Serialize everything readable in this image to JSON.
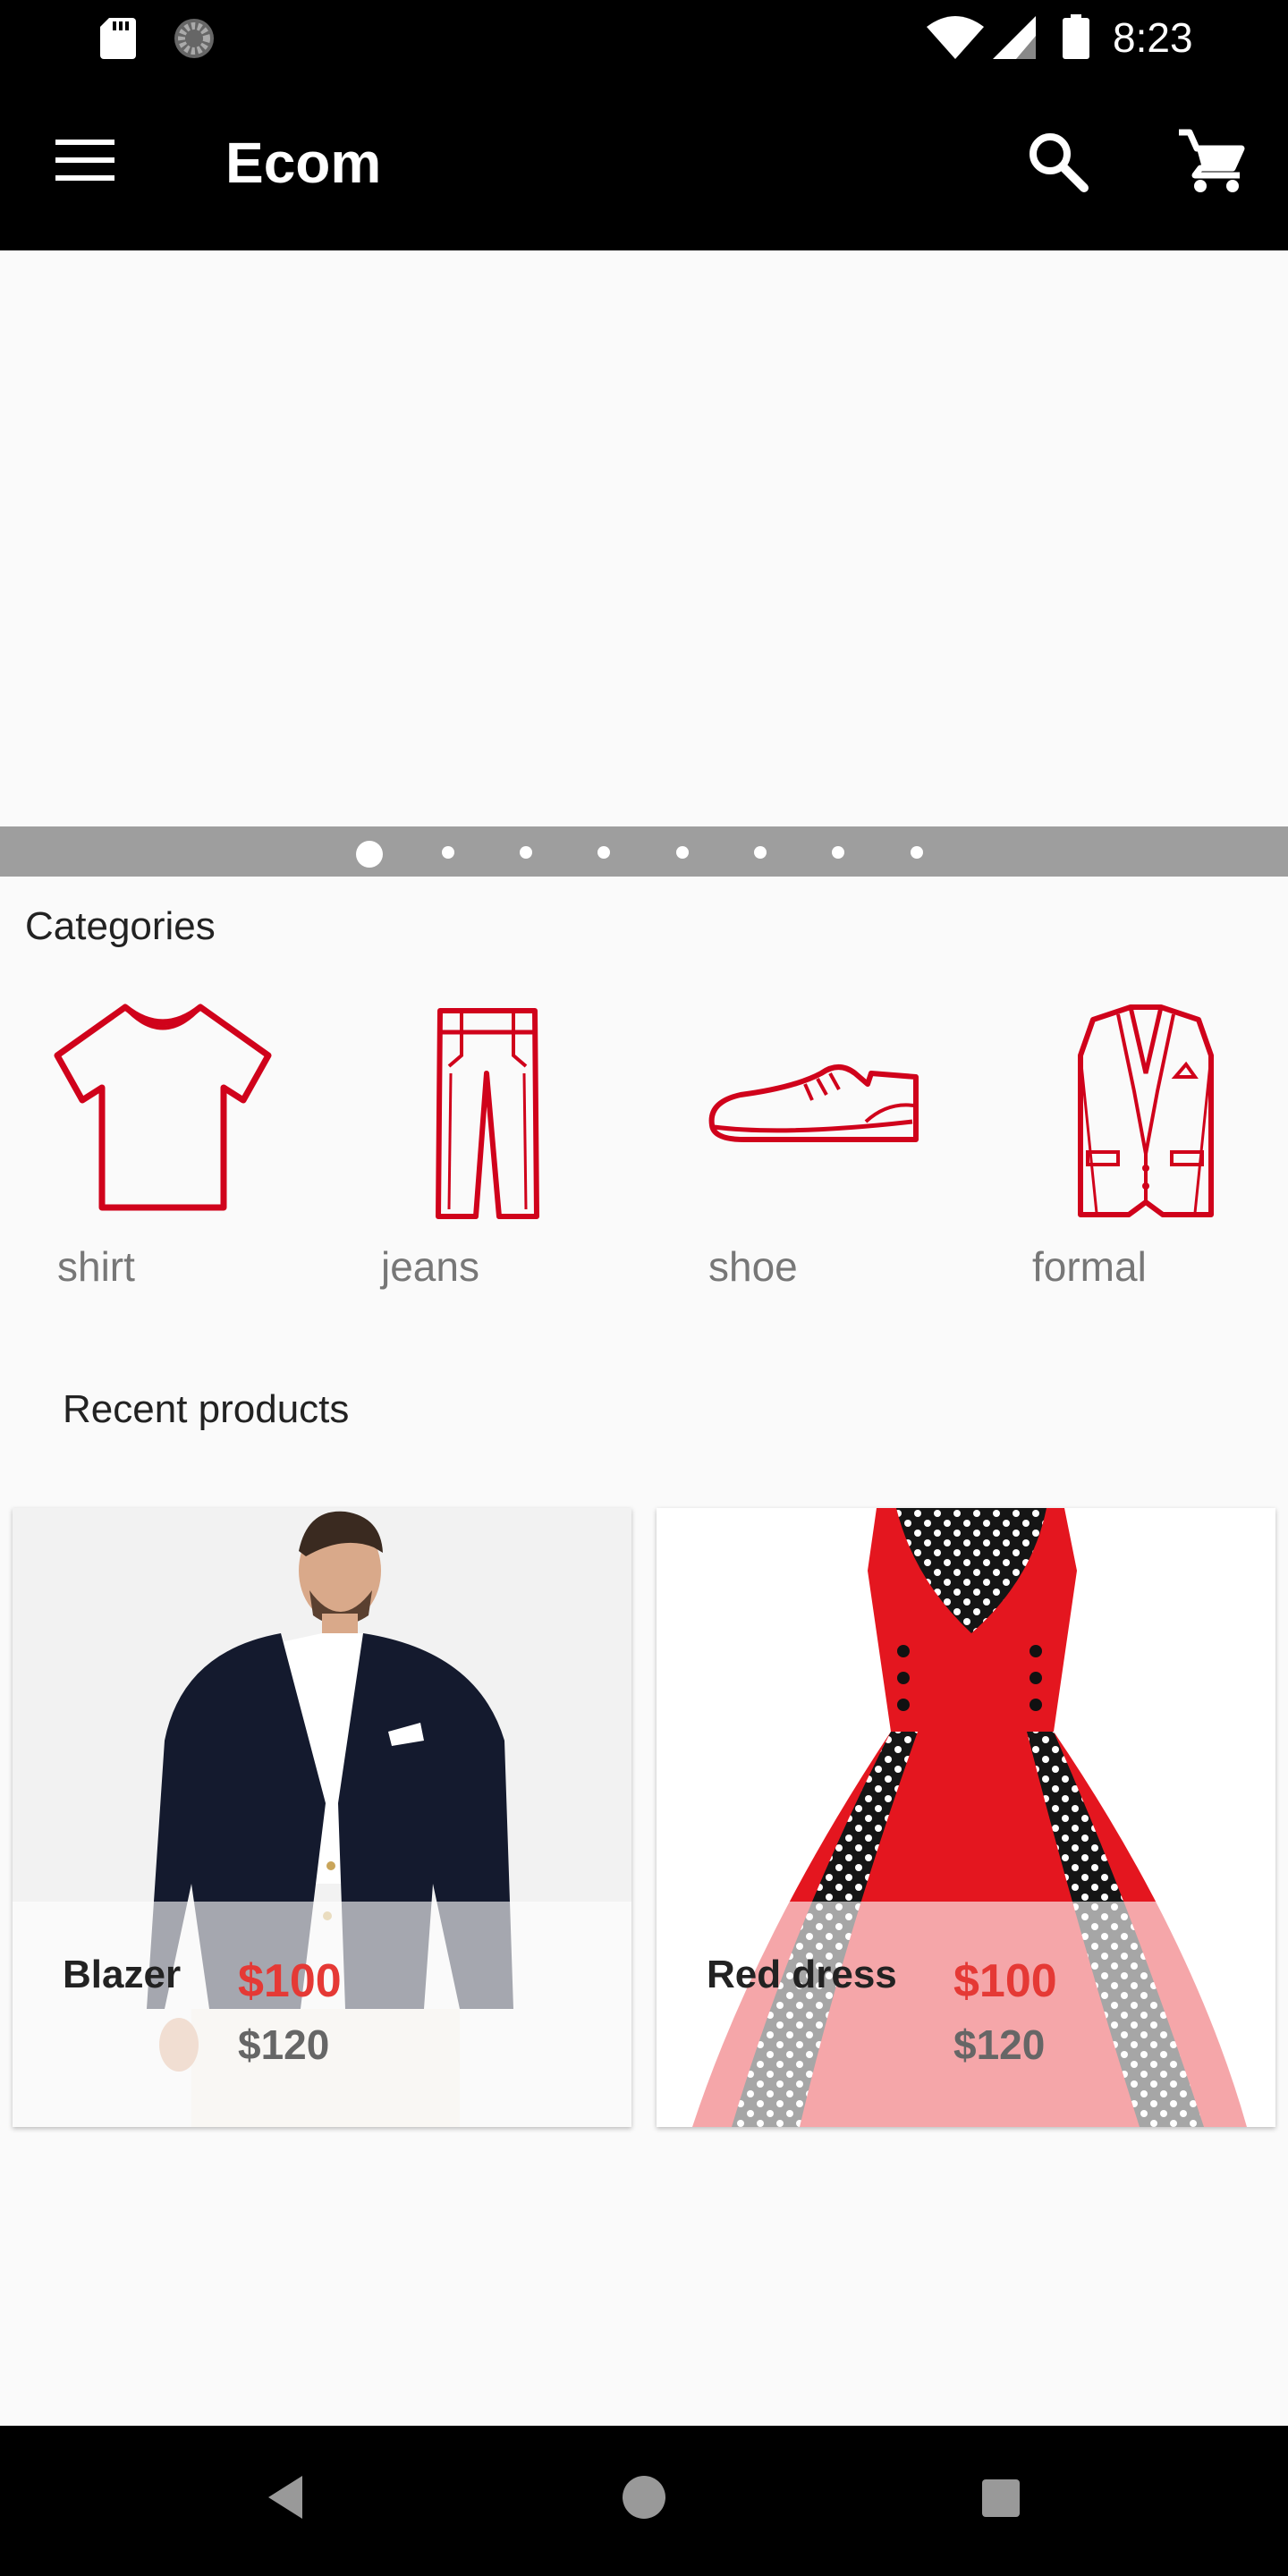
{
  "status_bar": {
    "time": "8:23",
    "icons": [
      "sd-card-icon",
      "spinner-icon",
      "wifi-icon",
      "signal-icon",
      "battery-icon"
    ]
  },
  "app_bar": {
    "title": "Ecom",
    "icons": [
      "menu-icon",
      "search-icon",
      "cart-icon"
    ]
  },
  "carousel": {
    "dot_count": 8,
    "active_index": 0
  },
  "categories": {
    "title": "Categories",
    "items": [
      {
        "label": "shirt",
        "icon": "shirt-icon"
      },
      {
        "label": "jeans",
        "icon": "jeans-icon"
      },
      {
        "label": "shoe",
        "icon": "shoe-icon"
      },
      {
        "label": "formal",
        "icon": "formal-suit-icon"
      }
    ]
  },
  "recent_products": {
    "title": "Recent products",
    "items": [
      {
        "name": "Blazer",
        "price": "$100",
        "old_price": "$120",
        "image": "blazer-photo"
      },
      {
        "name": "Red dress",
        "price": "$100",
        "old_price": "$120",
        "image": "red-dress-photo"
      }
    ]
  },
  "nav_bar": {
    "icons": [
      "back-icon",
      "home-icon",
      "recents-icon"
    ]
  },
  "colors": {
    "accent_red": "#d0021b",
    "price_red": "#e53935",
    "app_bar_bg": "#000000",
    "indicator_bg": "#9e9e9e"
  }
}
